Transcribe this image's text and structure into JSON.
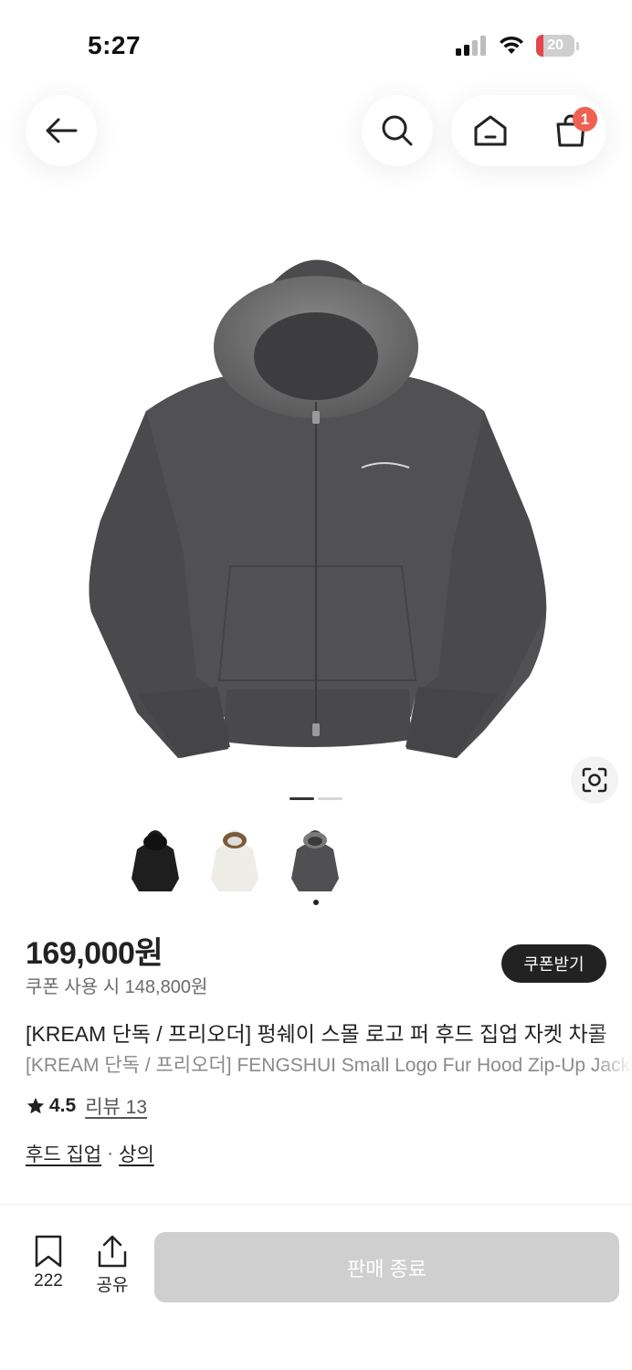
{
  "status": {
    "time": "5:27",
    "battery": "20",
    "battery_level": 0.2
  },
  "header": {
    "back_icon": "arrow-left-icon",
    "search_icon": "search-icon",
    "home_icon": "home-icon",
    "cart_icon": "shopping-bag-icon",
    "cart_badge": "1"
  },
  "gallery": {
    "current_image": 1,
    "total_images": 2,
    "thumbnails": [
      {
        "color": "black"
      },
      {
        "color": "ivory"
      },
      {
        "color": "charcoal"
      }
    ],
    "selected_thumbnail": 3
  },
  "product": {
    "price": "169,000원",
    "coupon_price": "쿠폰 사용 시 148,800원",
    "coupon_button": "쿠폰받기",
    "title_ko": "[KREAM 단독 / 프리오더] 펑쉐이 스몰 로고 퍼 후드 집업 자켓 차콜",
    "title_en": "[KREAM 단독 / 프리오더] FENGSHUI Small Logo Fur Hood Zip-Up Jacket Charcoal",
    "rating": "4.5",
    "review_link": "리뷰 13",
    "categories": [
      "후드 집업",
      "상의"
    ],
    "category_separator": "·"
  },
  "bottom_bar": {
    "bookmark_count": "222",
    "share_label": "공유",
    "buy_button": "판매 종료"
  },
  "colors": {
    "accent_badge": "#ef6253",
    "disabled_button": "#cfcfcf",
    "coupon_button": "#222222"
  }
}
